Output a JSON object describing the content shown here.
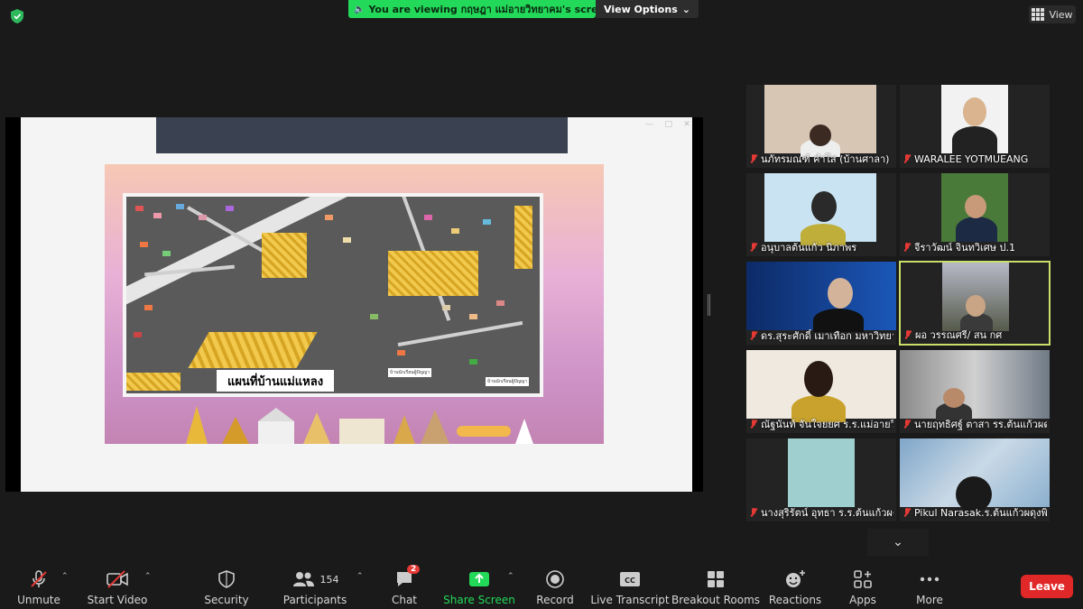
{
  "banner": {
    "viewing_text": "You are viewing กฤษฎา แม่อายวิทยาคม's screen",
    "view_options": "View Options",
    "view_button": "View"
  },
  "shared_slide": {
    "map_title": "แผนที่บ้านแม่แหลง",
    "note_left": "บ้านนักเรียนผู้ปัญญา",
    "note_right": "บ้านนักเรียนผู้ปัญญา"
  },
  "participants": [
    {
      "name": "นภัทรมณฑ์ คำใส (บ้านศาลา)",
      "muted": true
    },
    {
      "name": "WARALEE YOTMUEANG",
      "muted": true
    },
    {
      "name": "อนุบาลต้นแก้ว นิภาพร",
      "muted": true
    },
    {
      "name": "จีราวัฒน์ จินทวิเศษ ป.1",
      "muted": true
    },
    {
      "name": "ดร.สุระศักดิ์ เมาเทือก มหาวิทยาลัย",
      "muted": true
    },
    {
      "name": "ผอ วรรณศรี/ สน กศ",
      "muted": true
    },
    {
      "name": "ณัฐนันท์ จันใจยยศ ร.ร.แม่อายวิทยาคม",
      "muted": true
    },
    {
      "name": "นายฤทธิศฐ์ ตาสา รร.ต้นแก้วผดุงพิทยาลัย",
      "muted": true
    },
    {
      "name": "นางสุริรัตน์ อุทธา ร.ร.ต้นแก้วผดุงพิทยาลัย",
      "muted": true
    },
    {
      "name": "Pikul Narasak.ร.ต้นแก้วผดุงพิทยาลัย",
      "muted": true
    }
  ],
  "toolbar": {
    "unmute": "Unmute",
    "start_video": "Start Video",
    "security": "Security",
    "participants": "Participants",
    "participants_count": "154",
    "chat": "Chat",
    "chat_badge": "2",
    "share_screen": "Share Screen",
    "record": "Record",
    "live_transcript": "Live Transcript",
    "breakout_rooms": "Breakout Rooms",
    "reactions": "Reactions",
    "apps": "Apps",
    "more": "More",
    "leave": "Leave"
  },
  "colors": {
    "banner_green": "#23d959",
    "leave_red": "#e02828",
    "active_speaker": "#c9df6a",
    "share_green": "#23d959"
  },
  "icons": {
    "security": "shield-icon",
    "chat": "chat-bubble-icon",
    "participants": "people-icon"
  }
}
